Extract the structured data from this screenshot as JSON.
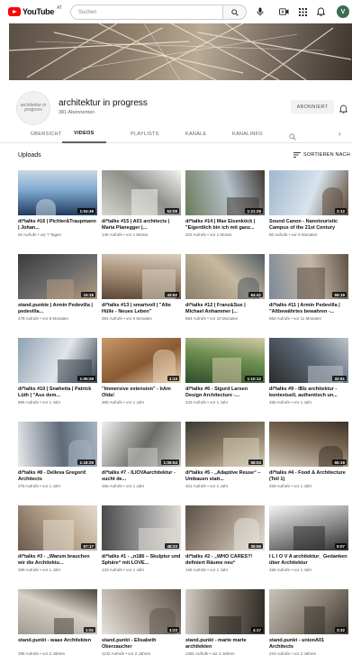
{
  "masthead": {
    "logo_text": "YouTube",
    "logo_region": "AT",
    "search_placeholder": "Suchen",
    "avatar_letter": "V",
    "colors": {
      "brand_red": "#ff0000"
    }
  },
  "channel": {
    "logo_text": "architektur in progress",
    "name": "architektur in progress",
    "subscribers": "381 Abonnenten",
    "subscribe_label": "ABONNIERT"
  },
  "tabs": [
    {
      "label": "ÜBERSICHT",
      "active": false
    },
    {
      "label": "VIDEOS",
      "active": true
    },
    {
      "label": "PLAYLISTS",
      "active": false
    },
    {
      "label": "KANÄLE",
      "active": false
    },
    {
      "label": "KANALINFO",
      "active": false
    }
  ],
  "uploads": {
    "title": "Uploads",
    "sort_label": "SORTIEREN NACH"
  },
  "videos": [
    {
      "title": "di*talks #16 | Pichler&Traupmann | Johan...",
      "meta": "92 Aufrufe • vor 7 Tagen",
      "duration": "1:04:49"
    },
    {
      "title": "di*talks #15 | A01 architects | Maria Planegger |...",
      "meta": "146 Aufrufe • vor 1 Monat",
      "duration": "53:09"
    },
    {
      "title": "di*talks #14 | Max Eisenköck | \"Eigentlich bin ich mit ganz...",
      "meta": "202 Aufrufe • vor 1 Monat",
      "duration": "1:21:26"
    },
    {
      "title": "Sound Canon - Nanotouristic Campus of the 21st Century",
      "meta": "80 Aufrufe • vor 5 Monaten",
      "duration": "2:12"
    },
    {
      "title": "stand.punkte | Armin Pedevilla | pedevilla...",
      "meta": "478 Aufrufe • vor 8 Monaten",
      "duration": "15:18"
    },
    {
      "title": "di*talks #13 | smartvoll | \"Alte Hülle - Neues Leben\"",
      "meta": "391 Aufrufe • vor 9 Monaten",
      "duration": "43:52"
    },
    {
      "title": "di*talks #12 | Franz&Sue | Michael Anhammer |...",
      "meta": "684 Aufrufe • vor 10 Monaten",
      "duration": "54:41"
    },
    {
      "title": "di*talks #11 | Armin Pedevilla | \"Altbewährtes bewahren -...",
      "meta": "982 Aufrufe • vor 11 Monaten",
      "duration": "59:19"
    },
    {
      "title": "di*talks #10 | Snøhetta | Patrick Lüth | \"Aus dem...",
      "meta": "895 Aufrufe • vor 1 Jahr",
      "duration": "1:05:29"
    },
    {
      "title": "\"Immersive extension\" - bAm Olda!",
      "meta": "385 Aufrufe • vor 1 Jahr",
      "duration": "1:13"
    },
    {
      "title": "di*talks #6 - Sigurd Larsen Design Architecture -...",
      "meta": "343 Aufrufe • vor 1 Jahr",
      "duration": "1:10:12"
    },
    {
      "title": "di*talks #9 - IBIz architektur - kontextuell, authentisch un...",
      "meta": "455 Aufrufe • vor 1 Jahr",
      "duration": "32:51"
    },
    {
      "title": "di*talks #8 - Delleva Gregorič Architects",
      "meta": "278 Aufrufe • vor 1 Jahr",
      "duration": "1:18:29"
    },
    {
      "title": "di*talks #7 - ILIOVAarchitektur - sucht de...",
      "meta": "466 Aufrufe • vor 1 Jahr",
      "duration": "1:06:54"
    },
    {
      "title": "di*talks #5 - „Adaptive Reuse“ – Umbauen statt...",
      "meta": "401 Aufrufe • vor 1 Jahr",
      "duration": "58:04"
    },
    {
      "title": "di*talks #4 - Food & Architecture (Teil 1)",
      "meta": "269 Aufrufe • vor 1 Jahr",
      "duration": "55:19"
    },
    {
      "title": "di*talks #3 - „Warum brauchen wir die Architektu...",
      "meta": "289 Aufrufe • vor 1 Jahr",
      "duration": "57:17"
    },
    {
      "title": "di*talks #1 - „n186 – Skulptur und Sphäre“ mit LOVE...",
      "meta": "133 Aufrufe • vor 1 Jahr",
      "duration": "48:23"
    },
    {
      "title": "di*talks #2 - „WHO CARES?! definiert Räume neu“",
      "meta": "165 Aufrufe • vor 1 Jahr",
      "duration": "35:56"
    },
    {
      "title": "I L I O V A architektur_ Gedanken über Architektur",
      "meta": "458 Aufrufe • vor 1 Jahr",
      "duration": "5:07"
    },
    {
      "title": "stand.punkt - waax Architekten",
      "meta": "298 Aufrufe • vor 2 Jahren",
      "duration": "1:01"
    },
    {
      "title": "stand.punkt - Elisabeth Oberzaucher",
      "meta": "1132 Aufrufe • vor 2 Jahren",
      "duration": "4:23"
    },
    {
      "title": "stand.punkt - marte marte architekten",
      "meta": "1481 Aufrufe • vor 2 Jahren",
      "duration": "4:17"
    },
    {
      "title": "stand.punkt - unionA01 Architects",
      "meta": "224 Aufrufe • vor 2 Jahren",
      "duration": "3:32"
    }
  ]
}
